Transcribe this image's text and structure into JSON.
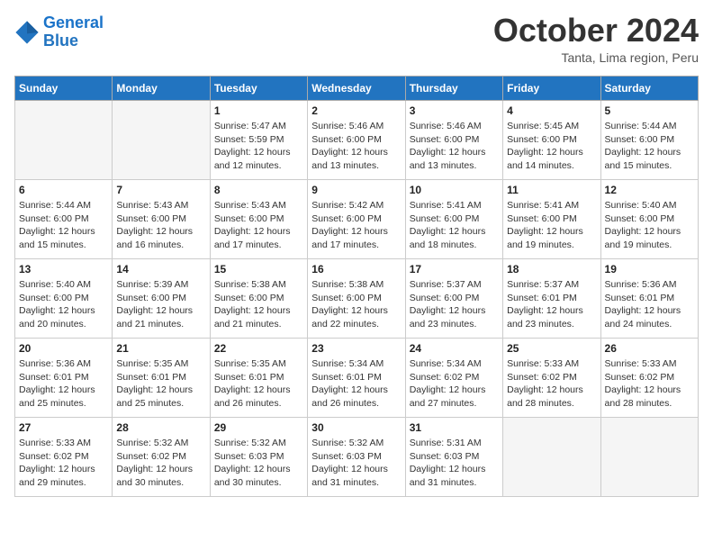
{
  "header": {
    "logo_line1": "General",
    "logo_line2": "Blue",
    "month_title": "October 2024",
    "subtitle": "Tanta, Lima region, Peru"
  },
  "days_of_week": [
    "Sunday",
    "Monday",
    "Tuesday",
    "Wednesday",
    "Thursday",
    "Friday",
    "Saturday"
  ],
  "weeks": [
    [
      {
        "day": "",
        "info": ""
      },
      {
        "day": "",
        "info": ""
      },
      {
        "day": "1",
        "info": "Sunrise: 5:47 AM\nSunset: 5:59 PM\nDaylight: 12 hours and 12 minutes."
      },
      {
        "day": "2",
        "info": "Sunrise: 5:46 AM\nSunset: 6:00 PM\nDaylight: 12 hours and 13 minutes."
      },
      {
        "day": "3",
        "info": "Sunrise: 5:46 AM\nSunset: 6:00 PM\nDaylight: 12 hours and 13 minutes."
      },
      {
        "day": "4",
        "info": "Sunrise: 5:45 AM\nSunset: 6:00 PM\nDaylight: 12 hours and 14 minutes."
      },
      {
        "day": "5",
        "info": "Sunrise: 5:44 AM\nSunset: 6:00 PM\nDaylight: 12 hours and 15 minutes."
      }
    ],
    [
      {
        "day": "6",
        "info": "Sunrise: 5:44 AM\nSunset: 6:00 PM\nDaylight: 12 hours and 15 minutes."
      },
      {
        "day": "7",
        "info": "Sunrise: 5:43 AM\nSunset: 6:00 PM\nDaylight: 12 hours and 16 minutes."
      },
      {
        "day": "8",
        "info": "Sunrise: 5:43 AM\nSunset: 6:00 PM\nDaylight: 12 hours and 17 minutes."
      },
      {
        "day": "9",
        "info": "Sunrise: 5:42 AM\nSunset: 6:00 PM\nDaylight: 12 hours and 17 minutes."
      },
      {
        "day": "10",
        "info": "Sunrise: 5:41 AM\nSunset: 6:00 PM\nDaylight: 12 hours and 18 minutes."
      },
      {
        "day": "11",
        "info": "Sunrise: 5:41 AM\nSunset: 6:00 PM\nDaylight: 12 hours and 19 minutes."
      },
      {
        "day": "12",
        "info": "Sunrise: 5:40 AM\nSunset: 6:00 PM\nDaylight: 12 hours and 19 minutes."
      }
    ],
    [
      {
        "day": "13",
        "info": "Sunrise: 5:40 AM\nSunset: 6:00 PM\nDaylight: 12 hours and 20 minutes."
      },
      {
        "day": "14",
        "info": "Sunrise: 5:39 AM\nSunset: 6:00 PM\nDaylight: 12 hours and 21 minutes."
      },
      {
        "day": "15",
        "info": "Sunrise: 5:38 AM\nSunset: 6:00 PM\nDaylight: 12 hours and 21 minutes."
      },
      {
        "day": "16",
        "info": "Sunrise: 5:38 AM\nSunset: 6:00 PM\nDaylight: 12 hours and 22 minutes."
      },
      {
        "day": "17",
        "info": "Sunrise: 5:37 AM\nSunset: 6:00 PM\nDaylight: 12 hours and 23 minutes."
      },
      {
        "day": "18",
        "info": "Sunrise: 5:37 AM\nSunset: 6:01 PM\nDaylight: 12 hours and 23 minutes."
      },
      {
        "day": "19",
        "info": "Sunrise: 5:36 AM\nSunset: 6:01 PM\nDaylight: 12 hours and 24 minutes."
      }
    ],
    [
      {
        "day": "20",
        "info": "Sunrise: 5:36 AM\nSunset: 6:01 PM\nDaylight: 12 hours and 25 minutes."
      },
      {
        "day": "21",
        "info": "Sunrise: 5:35 AM\nSunset: 6:01 PM\nDaylight: 12 hours and 25 minutes."
      },
      {
        "day": "22",
        "info": "Sunrise: 5:35 AM\nSunset: 6:01 PM\nDaylight: 12 hours and 26 minutes."
      },
      {
        "day": "23",
        "info": "Sunrise: 5:34 AM\nSunset: 6:01 PM\nDaylight: 12 hours and 26 minutes."
      },
      {
        "day": "24",
        "info": "Sunrise: 5:34 AM\nSunset: 6:02 PM\nDaylight: 12 hours and 27 minutes."
      },
      {
        "day": "25",
        "info": "Sunrise: 5:33 AM\nSunset: 6:02 PM\nDaylight: 12 hours and 28 minutes."
      },
      {
        "day": "26",
        "info": "Sunrise: 5:33 AM\nSunset: 6:02 PM\nDaylight: 12 hours and 28 minutes."
      }
    ],
    [
      {
        "day": "27",
        "info": "Sunrise: 5:33 AM\nSunset: 6:02 PM\nDaylight: 12 hours and 29 minutes."
      },
      {
        "day": "28",
        "info": "Sunrise: 5:32 AM\nSunset: 6:02 PM\nDaylight: 12 hours and 30 minutes."
      },
      {
        "day": "29",
        "info": "Sunrise: 5:32 AM\nSunset: 6:03 PM\nDaylight: 12 hours and 30 minutes."
      },
      {
        "day": "30",
        "info": "Sunrise: 5:32 AM\nSunset: 6:03 PM\nDaylight: 12 hours and 31 minutes."
      },
      {
        "day": "31",
        "info": "Sunrise: 5:31 AM\nSunset: 6:03 PM\nDaylight: 12 hours and 31 minutes."
      },
      {
        "day": "",
        "info": ""
      },
      {
        "day": "",
        "info": ""
      }
    ]
  ]
}
